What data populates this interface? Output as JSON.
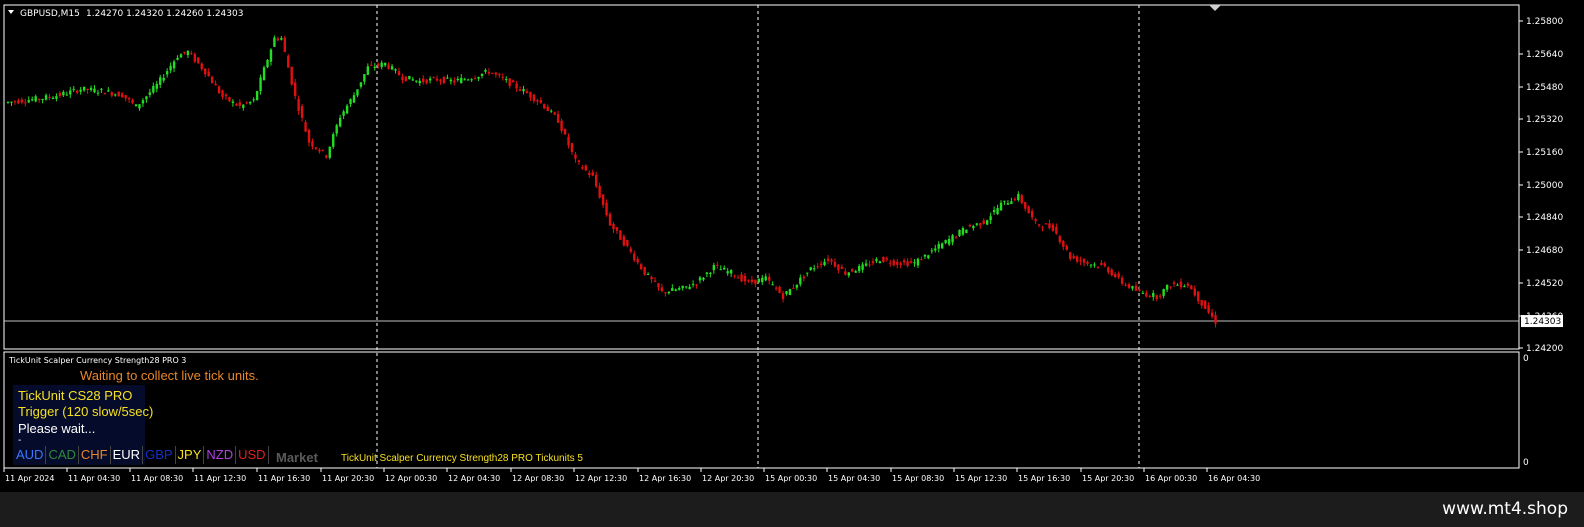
{
  "chart_header": {
    "symbol_tf": "GBPUSD,M15",
    "ohlc": "1.24270 1.24320 1.24260 1.24303"
  },
  "price_axis": {
    "labels": [
      "1.25800",
      "1.25640",
      "1.25480",
      "1.25320",
      "1.25160",
      "1.25000",
      "1.24840",
      "1.24680",
      "1.24520",
      "1.24360",
      "1.24200"
    ],
    "current_price": "1.24303"
  },
  "time_axis": {
    "labels": [
      "11 Apr 2024",
      "11 Apr 04:30",
      "11 Apr 08:30",
      "11 Apr 12:30",
      "11 Apr 16:30",
      "11 Apr 20:30",
      "12 Apr 00:30",
      "12 Apr 04:30",
      "12 Apr 08:30",
      "12 Apr 12:30",
      "12 Apr 16:30",
      "12 Apr 20:30",
      "15 Apr 00:30",
      "15 Apr 04:30",
      "15 Apr 08:30",
      "15 Apr 12:30",
      "15 Apr 16:30",
      "15 Apr 20:30",
      "16 Apr 00:30",
      "16 Apr 04:30"
    ]
  },
  "indicator": {
    "title": "TickUnit Scalper Currency Strength28 PRO 3",
    "waiting_message": "Waiting to collect live tick units.",
    "panel_line1": "TickUnit CS28 PRO",
    "panel_line2": "Trigger (120 slow/5sec)",
    "panel_line3": "Please wait...",
    "panel_dash": "-",
    "currencies": [
      {
        "code": "AUD",
        "color": "#3a78ff"
      },
      {
        "code": "CAD",
        "color": "#2e8b3a"
      },
      {
        "code": "CHF",
        "color": "#e8862a"
      },
      {
        "code": "EUR",
        "color": "#ffffff"
      },
      {
        "code": "GBP",
        "color": "#1530c8"
      },
      {
        "code": "JPY",
        "color": "#f6e020"
      },
      {
        "code": "NZD",
        "color": "#b040e0"
      },
      {
        "code": "USD",
        "color": "#e02020"
      }
    ],
    "market_label": "Market",
    "tick_label": "TickUnit Scalper Currency Strength28 PRO  Tickunits 5",
    "axis_top": "0",
    "axis_bottom": "0"
  },
  "footer": {
    "brand": "www.mt4.shop"
  },
  "colors": {
    "bull": "#22dd22",
    "bear": "#e01010",
    "grid": "#ffffff",
    "axis_text": "#ffffff"
  },
  "chart_data": {
    "type": "candlestick",
    "symbol": "GBPUSD",
    "timeframe": "M15",
    "ylim": [
      1.2416,
      1.2592
    ],
    "path_points": [
      [
        0,
        1.2542
      ],
      [
        4,
        1.2543
      ],
      [
        10,
        1.2544
      ],
      [
        16,
        1.2546
      ],
      [
        22,
        1.2549
      ],
      [
        28,
        1.2548
      ],
      [
        34,
        1.2546
      ],
      [
        38,
        1.254
      ],
      [
        44,
        1.2551
      ],
      [
        50,
        1.2566
      ],
      [
        53,
        1.2568
      ],
      [
        58,
        1.2558
      ],
      [
        63,
        1.2545
      ],
      [
        68,
        1.254
      ],
      [
        72,
        1.2543
      ],
      [
        78,
        1.2575
      ],
      [
        80,
        1.2575
      ],
      [
        84,
        1.2545
      ],
      [
        88,
        1.2522
      ],
      [
        93,
        1.2515
      ],
      [
        97,
        1.2535
      ],
      [
        101,
        1.2546
      ],
      [
        105,
        1.256
      ],
      [
        110,
        1.2562
      ],
      [
        115,
        1.2555
      ],
      [
        120,
        1.2553
      ],
      [
        125,
        1.2554
      ],
      [
        130,
        1.2553
      ],
      [
        135,
        1.2555
      ],
      [
        140,
        1.2558
      ],
      [
        145,
        1.2553
      ],
      [
        150,
        1.2548
      ],
      [
        155,
        1.2542
      ],
      [
        160,
        1.2533
      ],
      [
        165,
        1.2512
      ],
      [
        170,
        1.2504
      ],
      [
        175,
        1.248
      ],
      [
        180,
        1.2468
      ],
      [
        185,
        1.2455
      ],
      [
        190,
        1.2445
      ],
      [
        196,
        1.2447
      ],
      [
        200,
        1.245
      ],
      [
        205,
        1.2458
      ],
      [
        210,
        1.2455
      ],
      [
        215,
        1.245
      ],
      [
        220,
        1.2452
      ],
      [
        225,
        1.2443
      ],
      [
        228,
        1.2448
      ],
      [
        233,
        1.2457
      ],
      [
        238,
        1.2462
      ],
      [
        243,
        1.2455
      ],
      [
        248,
        1.2458
      ],
      [
        253,
        1.2462
      ],
      [
        258,
        1.246
      ],
      [
        263,
        1.246
      ],
      [
        268,
        1.2466
      ],
      [
        273,
        1.2472
      ],
      [
        278,
        1.2478
      ],
      [
        283,
        1.2481
      ],
      [
        288,
        1.249
      ],
      [
        293,
        1.2494
      ],
      [
        298,
        1.248
      ],
      [
        303,
        1.2478
      ],
      [
        308,
        1.2463
      ],
      [
        313,
        1.246
      ],
      [
        318,
        1.2458
      ],
      [
        323,
        1.245
      ],
      [
        328,
        1.2445
      ],
      [
        333,
        1.2443
      ],
      [
        337,
        1.2449
      ],
      [
        342,
        1.2449
      ],
      [
        347,
        1.2437
      ],
      [
        350,
        1.243
      ]
    ]
  }
}
